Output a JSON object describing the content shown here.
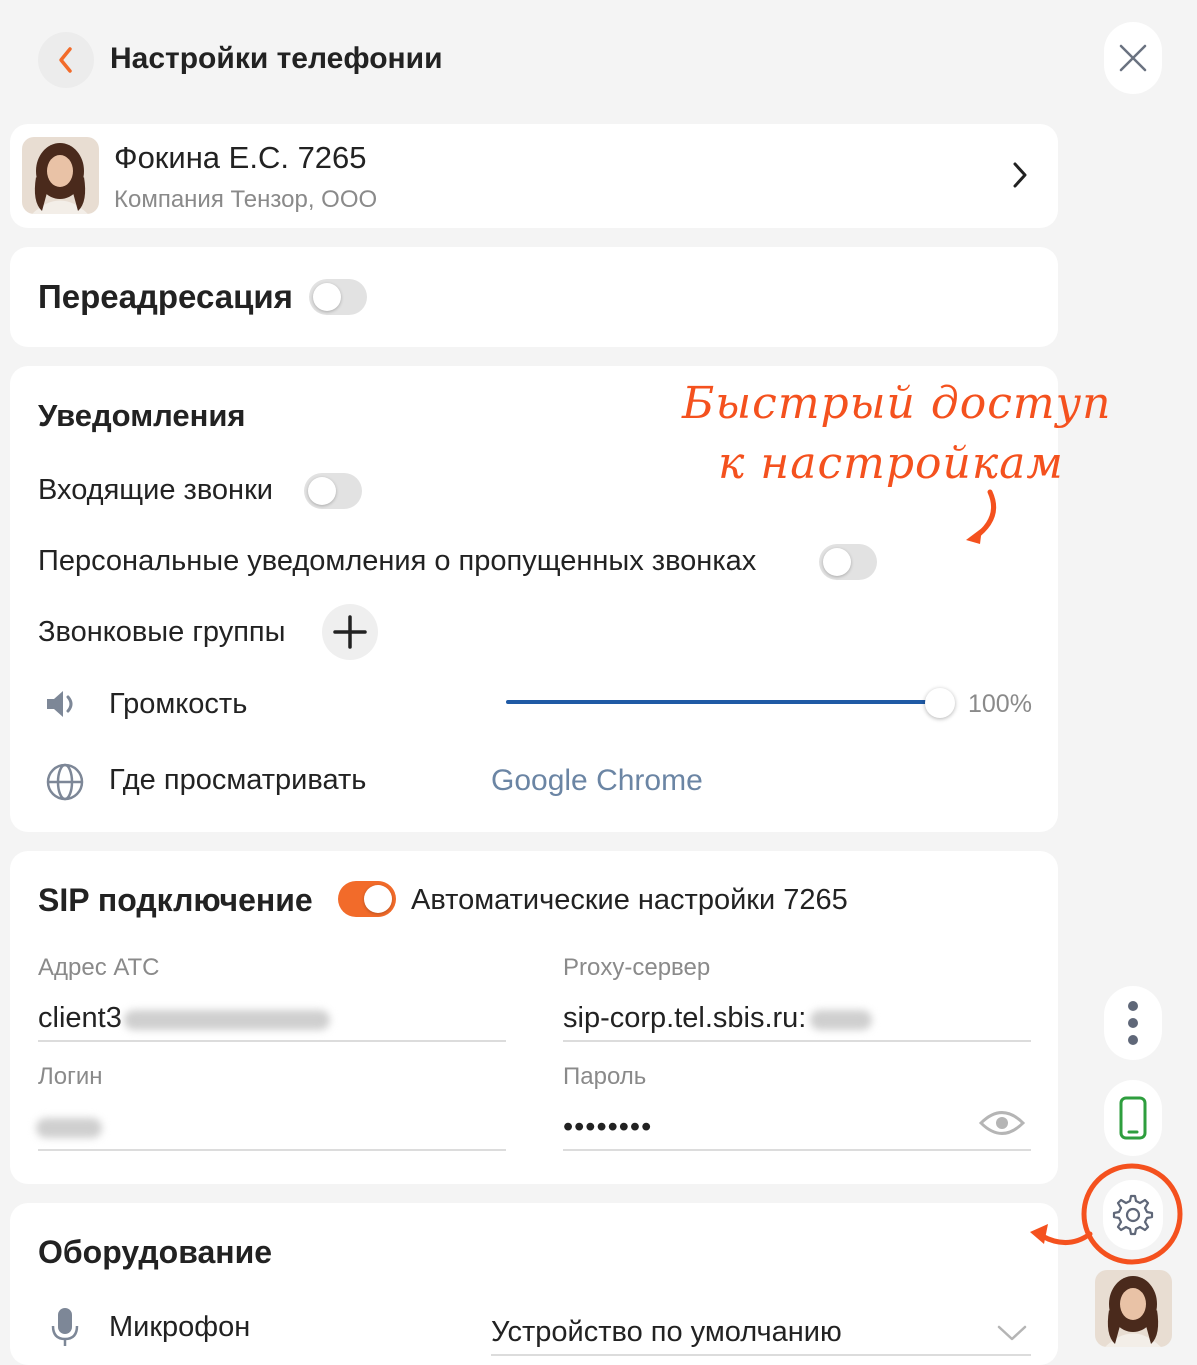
{
  "header": {
    "title": "Настройки телефонии"
  },
  "user": {
    "name": "Фокина Е.С.  7265",
    "company": "Компания Тензор, ООО"
  },
  "forwarding": {
    "label": "Переадресация",
    "enabled": false
  },
  "notifications": {
    "title": "Уведомления",
    "incoming_calls": {
      "label": "Входящие звонки",
      "enabled": false
    },
    "personal_missed": {
      "label": "Персональные уведомления о пропущенных звонках",
      "enabled": false
    },
    "call_groups": {
      "label": "Звонковые группы"
    },
    "volume": {
      "label": "Громкость",
      "value_text": "100%",
      "level": 1.0
    },
    "where_view": {
      "label": "Где просматривать",
      "value": "Google Chrome"
    }
  },
  "annotation": {
    "line1": "Быстрый доступ",
    "line2": "к настройкам"
  },
  "sip": {
    "title": "SIP подключение",
    "auto_enabled": true,
    "auto_label": "Автоматические настройки  7265",
    "pbx_address": {
      "label": "Адрес АТС",
      "value": "client3"
    },
    "proxy": {
      "label": "Proxy-сервер",
      "value": "sip-corp.tel.sbis.ru:"
    },
    "login": {
      "label": "Логин"
    },
    "password": {
      "label": "Пароль",
      "value": "••••••••"
    }
  },
  "equipment": {
    "title": "Оборудование",
    "microphone": {
      "label": "Микрофон",
      "value": "Устройство по умолчанию"
    }
  },
  "colors": {
    "accent": "#f26b2a",
    "annotation": "#f4511e",
    "slider": "#1f5aa5",
    "link": "#6b85a4",
    "phone_icon": "#2e9e3e"
  },
  "icons": [
    "chevron-left-icon",
    "close-icon",
    "chevron-right-icon",
    "plus-icon",
    "speaker-icon",
    "globe-icon",
    "eye-icon",
    "microphone-icon",
    "chevron-down-icon",
    "more-vertical-icon",
    "phone-icon",
    "gear-icon"
  ]
}
